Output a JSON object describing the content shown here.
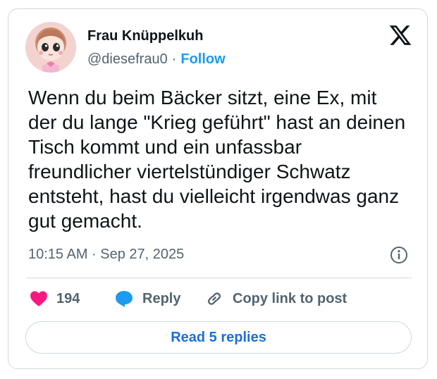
{
  "author": {
    "name": "Frau Knüppelkuh",
    "handle": "@diesefrau0",
    "separator": "·",
    "follow_label": "Follow"
  },
  "tweet": {
    "text": "Wenn du beim Bäcker sitzt, eine Ex, mit der du lange \"Krieg geführt\" hast an deinen Tisch kommt und ein unfassbar freundlicher viertelstündiger Schwatz entsteht, hast du vielleicht irgendwas ganz gut gemacht.",
    "timestamp": "10:15 AM · Sep 27, 2025"
  },
  "actions": {
    "like_count": "194",
    "reply_label": "Reply",
    "copy_label": "Copy link to post"
  },
  "footer": {
    "replies_label": "Read 5 replies"
  },
  "icons": {
    "platform_logo": "x-logo-icon",
    "like": "heart-icon",
    "reply": "speech-bubble-icon",
    "copy": "link-icon",
    "info": "info-icon"
  },
  "colors": {
    "accent": "#1d9bf0",
    "heart": "#f91880",
    "reply_bubble": "#1d9bf0",
    "muted_text": "#536471",
    "border": "#cfd9de"
  }
}
